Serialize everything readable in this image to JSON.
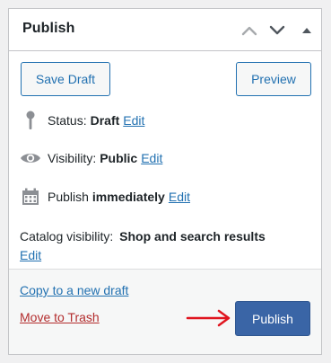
{
  "header": {
    "title": "Publish",
    "move_up_icon": "chevron-up-icon",
    "move_down_icon": "chevron-down-icon",
    "toggle_icon": "triangle-up-icon"
  },
  "actions": {
    "save_draft_label": "Save Draft",
    "preview_label": "Preview"
  },
  "status": {
    "icon": "pin-icon",
    "label": "Status:",
    "value": "Draft",
    "edit": "Edit"
  },
  "visibility": {
    "icon": "eye-icon",
    "label": "Visibility:",
    "value": "Public",
    "edit": "Edit"
  },
  "schedule": {
    "icon": "calendar-icon",
    "label": "Publish",
    "value": "immediately",
    "edit": "Edit"
  },
  "catalog": {
    "label": "Catalog visibility:",
    "value": "Shop and search results",
    "edit": "Edit"
  },
  "footer": {
    "copy_label": "Copy to a new draft",
    "trash_label": "Move to Trash",
    "publish_label": "Publish",
    "arrow_icon": "red-arrow-right-icon"
  },
  "colors": {
    "link": "#2271b1",
    "trash": "#b32d2e",
    "publish_button": "#3a65a6",
    "arrow": "#e0141e"
  }
}
